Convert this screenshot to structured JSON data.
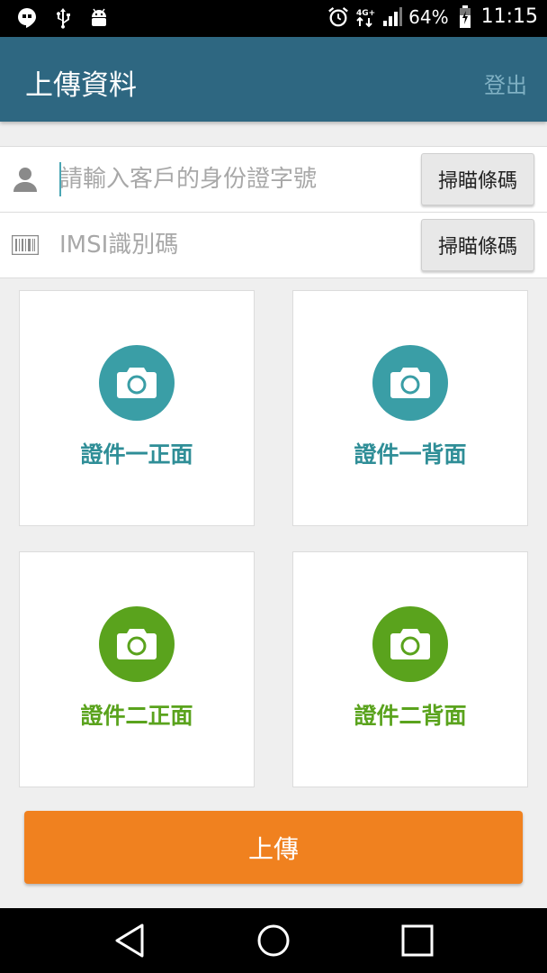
{
  "status_bar": {
    "battery": "64%",
    "time": "11:15",
    "icons": [
      "hangouts-icon",
      "usb-icon",
      "android-debug-icon",
      "alarm-icon",
      "4g-icon",
      "signal-icon",
      "battery-icon"
    ]
  },
  "app_bar": {
    "title": "上傳資料",
    "logout": "登出"
  },
  "form": {
    "id_field": {
      "placeholder": "請輸入客戶的身份證字號",
      "value": "",
      "scan_label": "掃瞄條碼"
    },
    "imsi_field": {
      "placeholder": "IMSI識別碼",
      "value": "",
      "scan_label": "掃瞄條碼"
    }
  },
  "cards": [
    {
      "label": "證件一正面",
      "color": "#3a9ea6"
    },
    {
      "label": "證件一背面",
      "color": "#3a9ea6"
    },
    {
      "label": "證件二正面",
      "color": "#5aa31d"
    },
    {
      "label": "證件二背面",
      "color": "#5aa31d"
    }
  ],
  "upload_label": "上傳",
  "colors": {
    "app_bar": "#2e6781",
    "upload": "#f0811f",
    "teal": "#3a9ea6",
    "green": "#5aa31d"
  }
}
